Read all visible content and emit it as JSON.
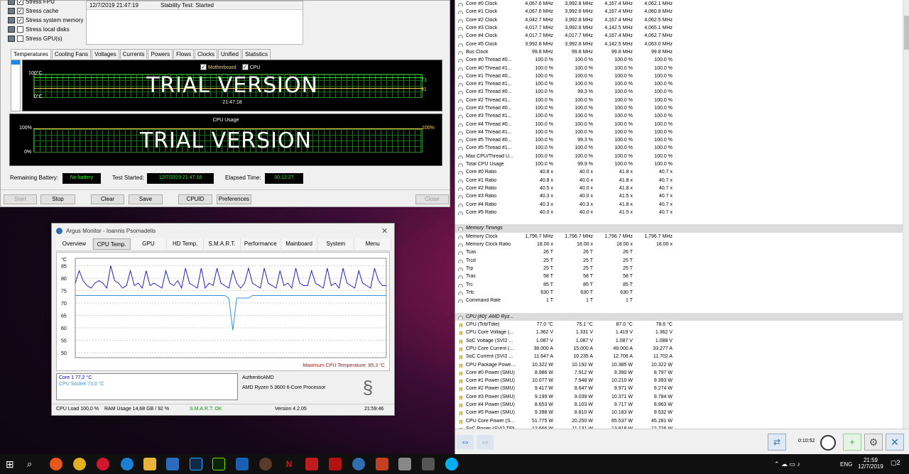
{
  "aida": {
    "stress": [
      {
        "label": "Stress FPU",
        "checked": true
      },
      {
        "label": "Stress cache",
        "checked": true
      },
      {
        "label": "Stress system memory",
        "checked": true
      },
      {
        "label": "Stress local disks",
        "checked": false
      },
      {
        "label": "Stress GPU(s)",
        "checked": false
      }
    ],
    "log": {
      "date": "12/7/2019 21:47:19",
      "status": "Stability Test: Started"
    },
    "tabs": [
      "Temperatures",
      "Cooling Fans",
      "Voltages",
      "Currents",
      "Powers",
      "Flows",
      "Clocks",
      "Unified",
      "Statistics"
    ],
    "temp_graph": {
      "legend_motherboard": "Motherboard",
      "legend_cpu": "CPU",
      "y_top": "100°C",
      "y_bottom": "0°C",
      "val1": "73",
      "val2": "31",
      "time": "21:47:18",
      "trial": "TRIAL VERSION"
    },
    "usage_graph": {
      "title": "CPU Usage",
      "y_top": "100%",
      "y_bottom": "0%",
      "right": "100%",
      "trial": "TRIAL VERSION"
    },
    "status": {
      "battery_label": "Remaining Battery:",
      "battery_value": "No battery",
      "started_label": "Test Started:",
      "started_value": "12/7/2019 21:47:18",
      "elapsed_label": "Elapsed Time:",
      "elapsed_value": "00:12:27"
    },
    "buttons": {
      "start": "Start",
      "stop": "Stop",
      "clear": "Clear",
      "save": "Save",
      "cpuid": "CPUID",
      "preferences": "Preferences",
      "close": "Close"
    }
  },
  "hwinfo": {
    "rows": [
      {
        "n": "Core #0 Clock",
        "v": [
          "4,067.6 MHz",
          "3,992.8 MHz",
          "4,167.4 MHz",
          "4,062.1 MHz"
        ],
        "t": "c"
      },
      {
        "n": "Core #1 Clock",
        "v": [
          "4,067.6 MHz",
          "3,992.8 MHz",
          "4,167.4 MHz",
          "4,060.8 MHz"
        ],
        "t": "c"
      },
      {
        "n": "Core #2 Clock",
        "v": [
          "4,042.7 MHz",
          "3,992.8 MHz",
          "4,167.4 MHz",
          "4,062.5 MHz"
        ],
        "t": "c"
      },
      {
        "n": "Core #3 Clock",
        "v": [
          "4,017.7 MHz",
          "3,992.8 MHz",
          "4,142.5 MHz",
          "4,065.1 MHz"
        ],
        "t": "c"
      },
      {
        "n": "Core #4 Clock",
        "v": [
          "4,017.7 MHz",
          "4,017.7 MHz",
          "4,167.4 MHz",
          "4,062.7 MHz"
        ],
        "t": "c"
      },
      {
        "n": "Core #5 Clock",
        "v": [
          "3,992.8 MHz",
          "3,992.8 MHz",
          "4,142.5 MHz",
          "4,063.0 MHz"
        ],
        "t": "c"
      },
      {
        "n": "Bus Clock",
        "v": [
          "99.8 MHz",
          "99.8 MHz",
          "99.8 MHz",
          "99.8 MHz"
        ],
        "t": "c"
      },
      {
        "n": "Core #0 Thread #0...",
        "v": [
          "100.0 %",
          "100.0 %",
          "100.0 %",
          "100.0 %"
        ],
        "t": "c"
      },
      {
        "n": "Core #0 Thread #1...",
        "v": [
          "100.0 %",
          "100.0 %",
          "100.0 %",
          "100.0 %"
        ],
        "t": "c"
      },
      {
        "n": "Core #1 Thread #0...",
        "v": [
          "100.0 %",
          "100.0 %",
          "100.0 %",
          "100.0 %"
        ],
        "t": "c"
      },
      {
        "n": "Core #1 Thread #1...",
        "v": [
          "100.0 %",
          "100.0 %",
          "100.0 %",
          "100.0 %"
        ],
        "t": "c"
      },
      {
        "n": "Core #2 Thread #0...",
        "v": [
          "100.0 %",
          "99.3 %",
          "100.0 %",
          "100.0 %"
        ],
        "t": "c"
      },
      {
        "n": "Core #2 Thread #1...",
        "v": [
          "100.0 %",
          "100.0 %",
          "100.0 %",
          "100.0 %"
        ],
        "t": "c"
      },
      {
        "n": "Core #3 Thread #0...",
        "v": [
          "100.0 %",
          "100.0 %",
          "100.0 %",
          "100.0 %"
        ],
        "t": "c"
      },
      {
        "n": "Core #3 Thread #1...",
        "v": [
          "100.0 %",
          "100.0 %",
          "100.0 %",
          "100.0 %"
        ],
        "t": "c"
      },
      {
        "n": "Core #4 Thread #0...",
        "v": [
          "100.0 %",
          "100.0 %",
          "100.0 %",
          "100.0 %"
        ],
        "t": "c"
      },
      {
        "n": "Core #4 Thread #1...",
        "v": [
          "100.0 %",
          "100.0 %",
          "100.0 %",
          "100.0 %"
        ],
        "t": "c"
      },
      {
        "n": "Core #5 Thread #0...",
        "v": [
          "100.0 %",
          "99.3 %",
          "100.0 %",
          "100.0 %"
        ],
        "t": "c"
      },
      {
        "n": "Core #5 Thread #1...",
        "v": [
          "100.0 %",
          "100.0 %",
          "100.0 %",
          "100.0 %"
        ],
        "t": "c"
      },
      {
        "n": "Max CPU/Thread U...",
        "v": [
          "100.0 %",
          "100.0 %",
          "100.0 %",
          "100.0 %"
        ],
        "t": "c"
      },
      {
        "n": "Total CPU Usage",
        "v": [
          "100.0 %",
          "99.9 %",
          "100.0 %",
          "100.0 %"
        ],
        "t": "c"
      },
      {
        "n": "Core #0 Ratio",
        "v": [
          "40.8 x",
          "40.0 x",
          "41.8 x",
          "40.7 x"
        ],
        "t": "c"
      },
      {
        "n": "Core #1 Ratio",
        "v": [
          "40.8 x",
          "40.0 x",
          "41.8 x",
          "40.7 x"
        ],
        "t": "c"
      },
      {
        "n": "Core #2 Ratio",
        "v": [
          "40.5 x",
          "40.0 x",
          "41.8 x",
          "40.7 x"
        ],
        "t": "c"
      },
      {
        "n": "Core #3 Ratio",
        "v": [
          "40.3 x",
          "40.0 x",
          "41.5 x",
          "40.7 x"
        ],
        "t": "c"
      },
      {
        "n": "Core #4 Ratio",
        "v": [
          "40.3 x",
          "40.3 x",
          "41.8 x",
          "40.7 x"
        ],
        "t": "c"
      },
      {
        "n": "Core #5 Ratio",
        "v": [
          "40.0 x",
          "40.0 x",
          "41.5 x",
          "40.7 x"
        ],
        "t": "c"
      },
      {
        "n": "",
        "v": [
          "",
          "",
          "",
          ""
        ],
        "t": "blank"
      },
      {
        "n": "Memory Timings",
        "v": [
          "",
          "",
          "",
          ""
        ],
        "t": "sec"
      },
      {
        "n": "Memory Clock",
        "v": [
          "1,796.7 MHz",
          "1,796.7 MHz",
          "1,796.7 MHz",
          "1,796.7 MHz"
        ],
        "t": "c"
      },
      {
        "n": "Memory Clock Ratio",
        "v": [
          "18.00 x",
          "18.00 x",
          "18.00 x",
          "18.00 x"
        ],
        "t": "c"
      },
      {
        "n": "Tcas",
        "v": [
          "26 T",
          "26 T",
          "26 T",
          ""
        ],
        "t": "c"
      },
      {
        "n": "Trcd",
        "v": [
          "25 T",
          "25 T",
          "25 T",
          ""
        ],
        "t": "c"
      },
      {
        "n": "Trp",
        "v": [
          "25 T",
          "25 T",
          "25 T",
          ""
        ],
        "t": "c"
      },
      {
        "n": "Tras",
        "v": [
          "58 T",
          "58 T",
          "58 T",
          ""
        ],
        "t": "c"
      },
      {
        "n": "Trc",
        "v": [
          "85 T",
          "85 T",
          "85 T",
          ""
        ],
        "t": "c"
      },
      {
        "n": "Trfc",
        "v": [
          "630 T",
          "630 T",
          "630 T",
          ""
        ],
        "t": "c"
      },
      {
        "n": "Command Rate",
        "v": [
          "1 T",
          "1 T",
          "1 T",
          ""
        ],
        "t": "c"
      },
      {
        "n": "",
        "v": [
          "",
          "",
          "",
          ""
        ],
        "t": "blank"
      },
      {
        "n": "CPU [#0]: AMD Ryz...",
        "v": [
          "",
          "",
          "",
          ""
        ],
        "t": "sec"
      },
      {
        "n": "CPU (Tctl/Tdie)",
        "v": [
          "77.0 °C",
          "75.1 °C",
          "87.0 °C",
          "78.6 °C"
        ],
        "t": "v"
      },
      {
        "n": "CPU Core Voltage (...",
        "v": [
          "1.362 V",
          "1.331 V",
          "1.419 V",
          "1.362 V"
        ],
        "t": "v"
      },
      {
        "n": "SoC Voltage (SVI2 ...",
        "v": [
          "1.087 V",
          "1.087 V",
          "1.087 V",
          "1.088 V"
        ],
        "t": "v"
      },
      {
        "n": "CPU Core Current (...",
        "v": [
          "38.000 A",
          "15.000 A",
          "49.000 A",
          "33.277 A"
        ],
        "t": "v"
      },
      {
        "n": "SoC Current (SVI2 ...",
        "v": [
          "11.647 A",
          "10.235 A",
          "12.706 A",
          "11.702 A"
        ],
        "t": "v"
      },
      {
        "n": "CPU Package Powe...",
        "v": [
          "10.322 W",
          "10.192 W",
          "10.385 W",
          "10.322 W"
        ],
        "t": "v"
      },
      {
        "n": "Core #0 Power (SMU)",
        "v": [
          "8.986 W",
          "7.912 W",
          "9.390 W",
          "8.797 W"
        ],
        "t": "v"
      },
      {
        "n": "Core #1 Power (SMU)",
        "v": [
          "10.077 W",
          "7.948 W",
          "10.210 W",
          "9.393 W"
        ],
        "t": "v"
      },
      {
        "n": "Core #2 Power (SMU)",
        "v": [
          "9.417 W",
          "8.647 W",
          "9.971 W",
          "9.274 W"
        ],
        "t": "v"
      },
      {
        "n": "Core #3 Power (SMU)",
        "v": [
          "9.199 W",
          "9.039 W",
          "10.371 W",
          "9.784 W"
        ],
        "t": "v"
      },
      {
        "n": "Core #4 Power (SMU)",
        "v": [
          "8.653 W",
          "8.103 W",
          "9.717 W",
          "8.963 W"
        ],
        "t": "v"
      },
      {
        "n": "Core #5 Power (SMU)",
        "v": [
          "9.398 W",
          "8.810 W",
          "10.183 W",
          "9.532 W"
        ],
        "t": "v"
      },
      {
        "n": "CPU Core Power (S...",
        "v": [
          "51.775 W",
          "20.250 W",
          "65.537 W",
          "45.281 W"
        ],
        "t": "v"
      },
      {
        "n": "SoC Power (SVI2 TFN)",
        "v": [
          "12.666 W",
          "11.131 W",
          "13.818 W",
          "12.726 W"
        ],
        "t": "v"
      }
    ],
    "timer": "0:10:52"
  },
  "argus": {
    "title": "Argus Monitor - Ioannis Psomadelis",
    "tabs": [
      "Overview",
      "CPU Temp.",
      "GPU",
      "HD Temp.",
      "S.M.A.R.T.",
      "Performance",
      "Mainboard",
      "System",
      "Menu"
    ],
    "chart_unit": "°C",
    "max_label": "Maximum CPU Temperature: 85,3 °C",
    "legend1": "Core 1 77,2 °C",
    "legend2": "CPU Socket 73,0 °C",
    "vendor": "AuthenticAMD",
    "model": "AMD Ryzen 5 3600 6-Core Processor",
    "status": {
      "cpu_load": "CPU Load 100,0 %",
      "ram": "RAM Usage 14,68 GB / 92 %",
      "smart": "S.M.A.R.T. OK",
      "version": "Version 4.2.05",
      "time": "21:59:46"
    }
  },
  "chart_data": {
    "type": "line",
    "ylim": [
      48,
      88
    ],
    "yticks": [
      "85",
      "80",
      "75",
      "70",
      "65",
      "60",
      "55",
      "50"
    ],
    "series": [
      {
        "name": "Core 1",
        "values": [
          78,
          83,
          79,
          77,
          76,
          78,
          79,
          78,
          76,
          85,
          79,
          78,
          76,
          77,
          83,
          77,
          78,
          76,
          83,
          77,
          78,
          77,
          76,
          83,
          78,
          77,
          79,
          76,
          84,
          78,
          77,
          76,
          84,
          76,
          78,
          77,
          84,
          78,
          77,
          76,
          83,
          78,
          76,
          78,
          84,
          78,
          77,
          76,
          84,
          78,
          77,
          76,
          83,
          77,
          78,
          76,
          84,
          78,
          77,
          77,
          83,
          78,
          77,
          76,
          84,
          77,
          78,
          76,
          84,
          78,
          77,
          76,
          83,
          78,
          77,
          76,
          84,
          79,
          77,
          77
        ]
      },
      {
        "name": "CPU Socket",
        "values": [
          73,
          73,
          73,
          73,
          73,
          73,
          73,
          73,
          73,
          73,
          73,
          73,
          73,
          73,
          73,
          73,
          73,
          73,
          73,
          73,
          73,
          73,
          73,
          73,
          73,
          73,
          73,
          73,
          73,
          73,
          73,
          73,
          73,
          73,
          73,
          73,
          73,
          73,
          73,
          72,
          59,
          72,
          72,
          72,
          72,
          73,
          73,
          73,
          73,
          73,
          73,
          73,
          73,
          73,
          73,
          73,
          73,
          73,
          73,
          73,
          73,
          73,
          73,
          73,
          73,
          73,
          73,
          73,
          73,
          73,
          73,
          73,
          73,
          73,
          73,
          73,
          73,
          73,
          73,
          73
        ]
      }
    ]
  },
  "taskbar": {
    "lang": "ENG",
    "time": "21:59",
    "date": "12/7/2019",
    "notif": "2"
  }
}
